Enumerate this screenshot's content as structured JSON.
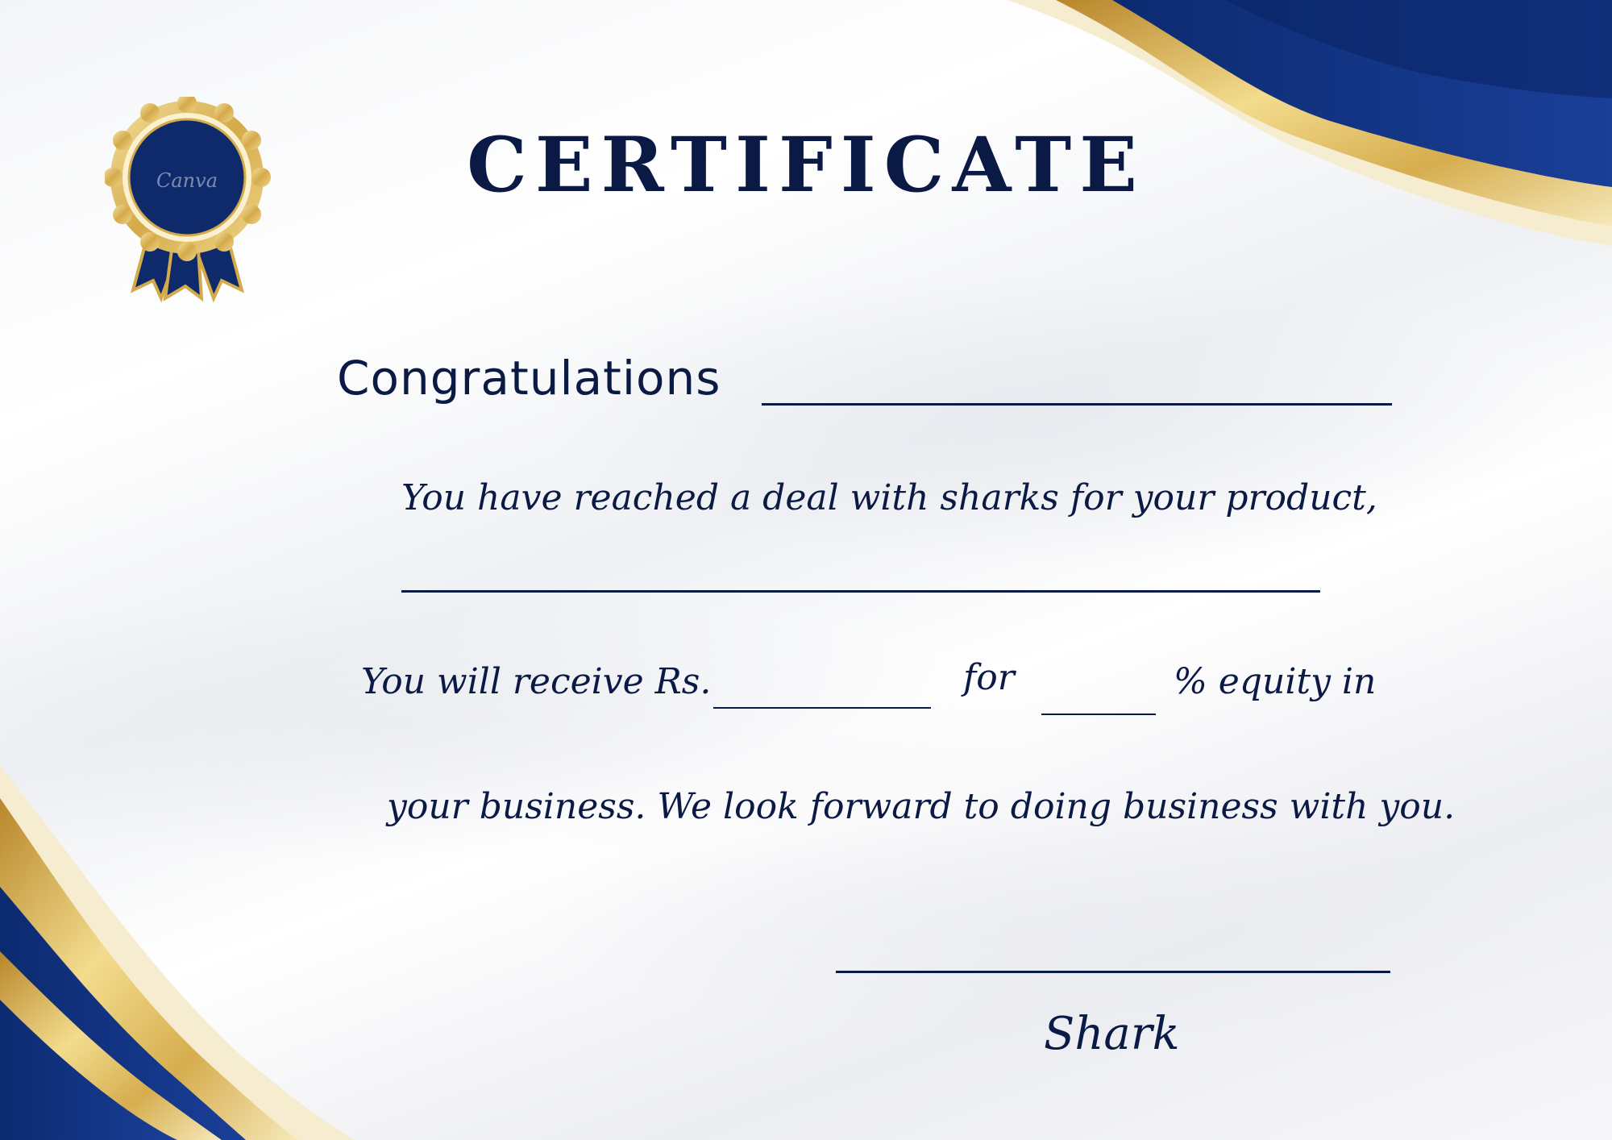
{
  "certificate": {
    "title": "CERTIFICATE",
    "congrats_label": "Congratulations",
    "line1": "You have reached a deal with sharks for your product,",
    "line2_prefix": "You will receive Rs.",
    "line2_for": "for",
    "line2_percent": "% equity in",
    "line3": "your business. We look forward to doing business with you.",
    "signature_label": "Shark"
  },
  "seal": {
    "brand_text": "Canva"
  },
  "colors": {
    "navy": "#0b1a45",
    "gold": "#d4aa4a",
    "blue": "#123a8c"
  }
}
